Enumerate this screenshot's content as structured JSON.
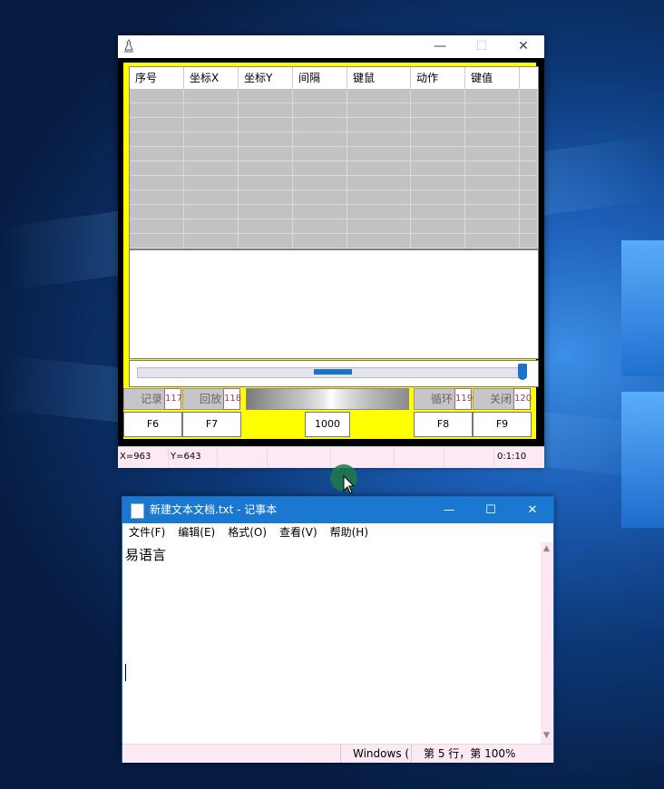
{
  "tool_window": {
    "columns": [
      "序号",
      "坐标X",
      "坐标Y",
      "间隔",
      "键鼠",
      "动作",
      "键值"
    ],
    "buttons": {
      "record": {
        "label": "记录",
        "code": "117"
      },
      "playback": {
        "label": "回放",
        "code": "118"
      },
      "loop": {
        "label": "循环",
        "code": "119"
      },
      "close": {
        "label": "关闭",
        "code": "120"
      }
    },
    "fkeys": {
      "f6": "F6",
      "f7": "F7",
      "interval": "1000",
      "f8": "F8",
      "f9": "F9"
    },
    "status": {
      "x": "X=963",
      "y": "Y=643",
      "time": "0:1:10"
    }
  },
  "notepad": {
    "title": "新建文本文档.txt - 记事本",
    "menu": [
      "文件(F)",
      "编辑(E)",
      "格式(O)",
      "查看(V)",
      "帮助(H)"
    ],
    "content": "易语言",
    "status": {
      "encoding": "Windows (",
      "position": "第 5 行，第 100%"
    }
  }
}
